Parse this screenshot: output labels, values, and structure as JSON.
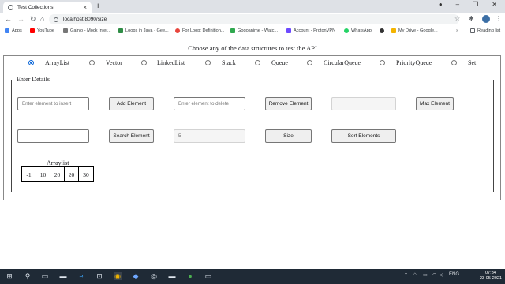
{
  "browser": {
    "tab_title": "Test Collections",
    "new_tab_glyph": "+",
    "close_tab_glyph": "×",
    "url": "localhost:8090/size",
    "reading_list": "Reading list",
    "bookmarks": [
      {
        "label": "Apps",
        "icon": "apps-grid-icon",
        "color": "#4285f4"
      },
      {
        "label": "YouTube",
        "icon": "youtube-icon",
        "color": "#ff0000"
      },
      {
        "label": "Gainlo - Mock Inter...",
        "icon": "gainlo-icon",
        "color": "#777777"
      },
      {
        "label": "Loops in Java - Gee...",
        "icon": "geeks-icon",
        "color": "#2f8d46"
      },
      {
        "label": "For Loop: Definition...",
        "icon": "chrome-icon",
        "color": "#e8453c"
      },
      {
        "label": "Gogoanime - Watc...",
        "icon": "gogo-icon",
        "color": "#2fa84f"
      },
      {
        "label": "Account - ProtonVPN",
        "icon": "proton-icon",
        "color": "#6d4aff"
      },
      {
        "label": "WhatsApp",
        "icon": "whatsapp-icon",
        "color": "#25d366"
      },
      {
        "label": "",
        "icon": "github-icon",
        "color": "#333333"
      },
      {
        "label": "My Drive - Google...",
        "icon": "drive-icon",
        "color": "#f4b400"
      }
    ],
    "more_bookmarks": "»"
  },
  "page": {
    "heading": "Choose any of the data structures to test the API",
    "structures": [
      {
        "label": "ArrayList",
        "checked": true
      },
      {
        "label": "Vector",
        "checked": false
      },
      {
        "label": "LinkedList",
        "checked": false
      },
      {
        "label": "Stack",
        "checked": false
      },
      {
        "label": "Queue",
        "checked": false
      },
      {
        "label": "CircularQueue",
        "checked": false
      },
      {
        "label": "PriorityQueue",
        "checked": false
      },
      {
        "label": "Set",
        "checked": false
      }
    ],
    "legend": "Enter Details",
    "insert_placeholder": "Enter element to insert",
    "add_button": "Add Element",
    "delete_placeholder": "Enter element to delete",
    "remove_button": "Remove Element",
    "max_value": "",
    "max_button": "Max Element",
    "search_value": "",
    "search_button": "Search Element",
    "size_value": "5",
    "size_button": "Size",
    "sort_button": "Sort Elements",
    "array_caption": "Arraylist",
    "array_values": [
      "-1",
      "10",
      "20",
      "20",
      "30"
    ]
  },
  "taskbar": {
    "language": "ENG",
    "time": "07:34",
    "date": "23-05-2021"
  }
}
